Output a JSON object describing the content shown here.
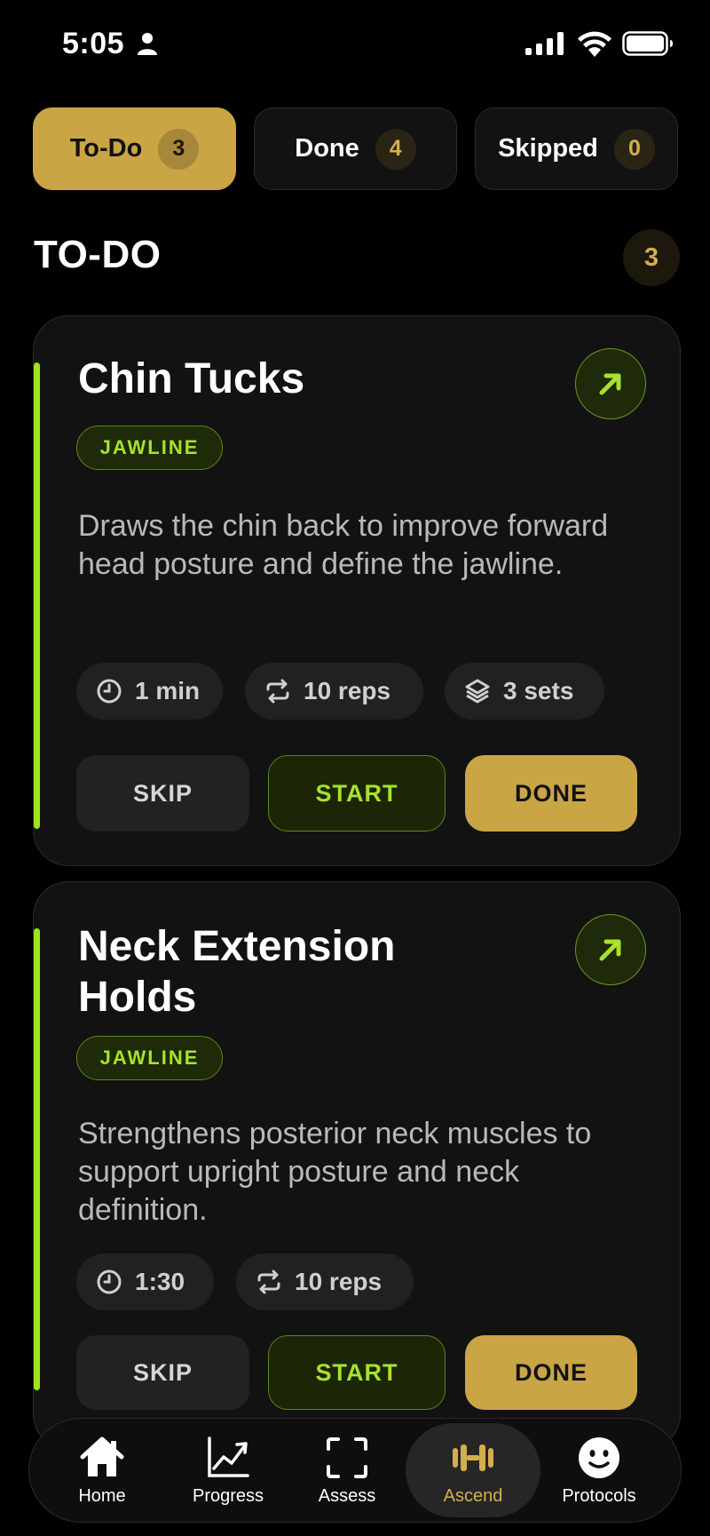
{
  "status_bar": {
    "time": "5:05"
  },
  "tabs": [
    {
      "label": "To-Do",
      "count": "3"
    },
    {
      "label": "Done",
      "count": "4"
    },
    {
      "label": "Skipped",
      "count": "0"
    }
  ],
  "section": {
    "title": "TO-DO",
    "count": "3"
  },
  "cards": [
    {
      "title": "Chin Tucks",
      "tag": "JAWLINE",
      "description": "Draws the chin back to improve forward head posture and define the jawline.",
      "stats": [
        {
          "icon": "clock-icon",
          "label": "1 min"
        },
        {
          "icon": "repeat-icon",
          "label": "10 reps"
        },
        {
          "icon": "layers-icon",
          "label": "3 sets"
        }
      ],
      "skip_label": "SKIP",
      "start_label": "START",
      "done_label": "DONE"
    },
    {
      "title": "Neck Extension Holds",
      "tag": "JAWLINE",
      "description": "Strengthens posterior neck muscles to support upright posture and neck definition.",
      "stats": [
        {
          "icon": "clock-icon",
          "label": "1:30"
        },
        {
          "icon": "repeat-icon",
          "label": "10 reps"
        }
      ],
      "skip_label": "SKIP",
      "start_label": "START",
      "done_label": "DONE"
    }
  ],
  "nav": [
    {
      "label": "Home",
      "icon": "home-icon"
    },
    {
      "label": "Progress",
      "icon": "chart-icon"
    },
    {
      "label": "Assess",
      "icon": "scan-icon"
    },
    {
      "label": "Ascend",
      "icon": "dumbbell-icon"
    },
    {
      "label": "Protocols",
      "icon": "smiley-icon"
    }
  ],
  "colors": {
    "gold": "#c9a546",
    "lime": "#a6e22e",
    "background": "#000000",
    "card": "#121212"
  }
}
